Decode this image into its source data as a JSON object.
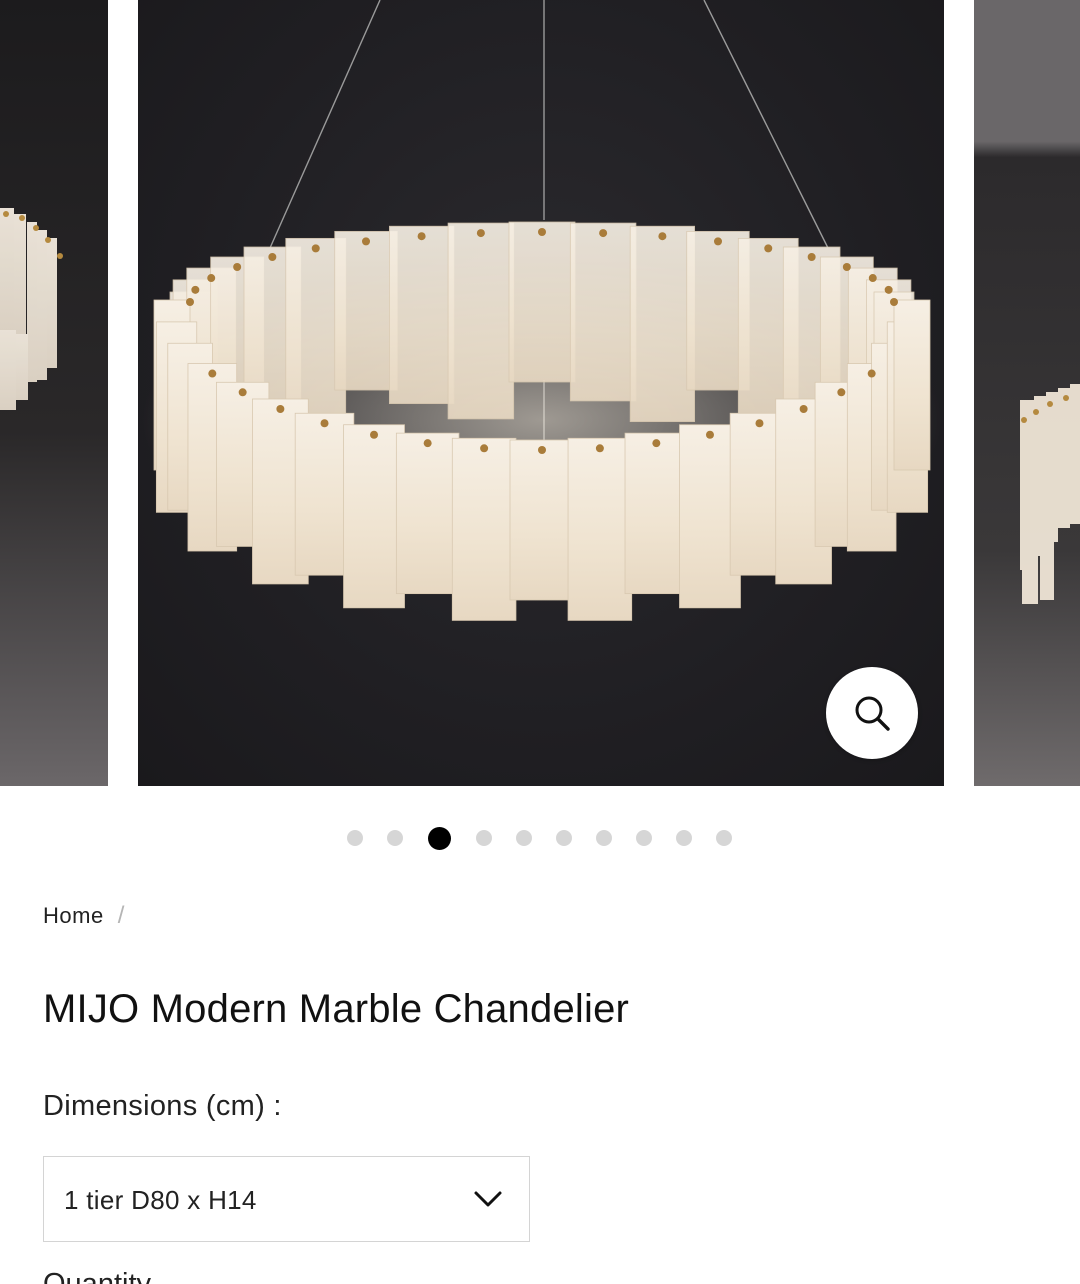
{
  "gallery": {
    "zoom_icon": "magnifier-icon",
    "slide_count": 10,
    "active_index": 2
  },
  "breadcrumb": {
    "home": "Home",
    "separator": "/"
  },
  "product": {
    "title": "MIJO Modern Marble Chandelier"
  },
  "options": {
    "dimensions_label": "Dimensions (cm) :",
    "dimensions_value": "1 tier D80 x H14",
    "chevron_icon": "chevron-down-icon"
  },
  "quantity": {
    "label": "Quantity"
  }
}
